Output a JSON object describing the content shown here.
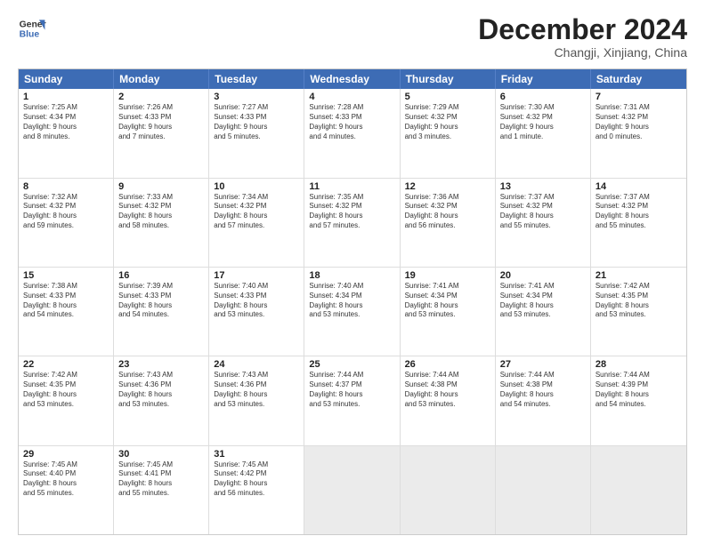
{
  "header": {
    "logo_line1": "General",
    "logo_line2": "Blue",
    "month": "December 2024",
    "location": "Changji, Xinjiang, China"
  },
  "days_of_week": [
    "Sunday",
    "Monday",
    "Tuesday",
    "Wednesday",
    "Thursday",
    "Friday",
    "Saturday"
  ],
  "rows": [
    [
      {
        "day": "1",
        "lines": [
          "Sunrise: 7:25 AM",
          "Sunset: 4:34 PM",
          "Daylight: 9 hours",
          "and 8 minutes."
        ]
      },
      {
        "day": "2",
        "lines": [
          "Sunrise: 7:26 AM",
          "Sunset: 4:33 PM",
          "Daylight: 9 hours",
          "and 7 minutes."
        ]
      },
      {
        "day": "3",
        "lines": [
          "Sunrise: 7:27 AM",
          "Sunset: 4:33 PM",
          "Daylight: 9 hours",
          "and 5 minutes."
        ]
      },
      {
        "day": "4",
        "lines": [
          "Sunrise: 7:28 AM",
          "Sunset: 4:33 PM",
          "Daylight: 9 hours",
          "and 4 minutes."
        ]
      },
      {
        "day": "5",
        "lines": [
          "Sunrise: 7:29 AM",
          "Sunset: 4:32 PM",
          "Daylight: 9 hours",
          "and 3 minutes."
        ]
      },
      {
        "day": "6",
        "lines": [
          "Sunrise: 7:30 AM",
          "Sunset: 4:32 PM",
          "Daylight: 9 hours",
          "and 1 minute."
        ]
      },
      {
        "day": "7",
        "lines": [
          "Sunrise: 7:31 AM",
          "Sunset: 4:32 PM",
          "Daylight: 9 hours",
          "and 0 minutes."
        ]
      }
    ],
    [
      {
        "day": "8",
        "lines": [
          "Sunrise: 7:32 AM",
          "Sunset: 4:32 PM",
          "Daylight: 8 hours",
          "and 59 minutes."
        ]
      },
      {
        "day": "9",
        "lines": [
          "Sunrise: 7:33 AM",
          "Sunset: 4:32 PM",
          "Daylight: 8 hours",
          "and 58 minutes."
        ]
      },
      {
        "day": "10",
        "lines": [
          "Sunrise: 7:34 AM",
          "Sunset: 4:32 PM",
          "Daylight: 8 hours",
          "and 57 minutes."
        ]
      },
      {
        "day": "11",
        "lines": [
          "Sunrise: 7:35 AM",
          "Sunset: 4:32 PM",
          "Daylight: 8 hours",
          "and 57 minutes."
        ]
      },
      {
        "day": "12",
        "lines": [
          "Sunrise: 7:36 AM",
          "Sunset: 4:32 PM",
          "Daylight: 8 hours",
          "and 56 minutes."
        ]
      },
      {
        "day": "13",
        "lines": [
          "Sunrise: 7:37 AM",
          "Sunset: 4:32 PM",
          "Daylight: 8 hours",
          "and 55 minutes."
        ]
      },
      {
        "day": "14",
        "lines": [
          "Sunrise: 7:37 AM",
          "Sunset: 4:32 PM",
          "Daylight: 8 hours",
          "and 55 minutes."
        ]
      }
    ],
    [
      {
        "day": "15",
        "lines": [
          "Sunrise: 7:38 AM",
          "Sunset: 4:33 PM",
          "Daylight: 8 hours",
          "and 54 minutes."
        ]
      },
      {
        "day": "16",
        "lines": [
          "Sunrise: 7:39 AM",
          "Sunset: 4:33 PM",
          "Daylight: 8 hours",
          "and 54 minutes."
        ]
      },
      {
        "day": "17",
        "lines": [
          "Sunrise: 7:40 AM",
          "Sunset: 4:33 PM",
          "Daylight: 8 hours",
          "and 53 minutes."
        ]
      },
      {
        "day": "18",
        "lines": [
          "Sunrise: 7:40 AM",
          "Sunset: 4:34 PM",
          "Daylight: 8 hours",
          "and 53 minutes."
        ]
      },
      {
        "day": "19",
        "lines": [
          "Sunrise: 7:41 AM",
          "Sunset: 4:34 PM",
          "Daylight: 8 hours",
          "and 53 minutes."
        ]
      },
      {
        "day": "20",
        "lines": [
          "Sunrise: 7:41 AM",
          "Sunset: 4:34 PM",
          "Daylight: 8 hours",
          "and 53 minutes."
        ]
      },
      {
        "day": "21",
        "lines": [
          "Sunrise: 7:42 AM",
          "Sunset: 4:35 PM",
          "Daylight: 8 hours",
          "and 53 minutes."
        ]
      }
    ],
    [
      {
        "day": "22",
        "lines": [
          "Sunrise: 7:42 AM",
          "Sunset: 4:35 PM",
          "Daylight: 8 hours",
          "and 53 minutes."
        ]
      },
      {
        "day": "23",
        "lines": [
          "Sunrise: 7:43 AM",
          "Sunset: 4:36 PM",
          "Daylight: 8 hours",
          "and 53 minutes."
        ]
      },
      {
        "day": "24",
        "lines": [
          "Sunrise: 7:43 AM",
          "Sunset: 4:36 PM",
          "Daylight: 8 hours",
          "and 53 minutes."
        ]
      },
      {
        "day": "25",
        "lines": [
          "Sunrise: 7:44 AM",
          "Sunset: 4:37 PM",
          "Daylight: 8 hours",
          "and 53 minutes."
        ]
      },
      {
        "day": "26",
        "lines": [
          "Sunrise: 7:44 AM",
          "Sunset: 4:38 PM",
          "Daylight: 8 hours",
          "and 53 minutes."
        ]
      },
      {
        "day": "27",
        "lines": [
          "Sunrise: 7:44 AM",
          "Sunset: 4:38 PM",
          "Daylight: 8 hours",
          "and 54 minutes."
        ]
      },
      {
        "day": "28",
        "lines": [
          "Sunrise: 7:44 AM",
          "Sunset: 4:39 PM",
          "Daylight: 8 hours",
          "and 54 minutes."
        ]
      }
    ],
    [
      {
        "day": "29",
        "lines": [
          "Sunrise: 7:45 AM",
          "Sunset: 4:40 PM",
          "Daylight: 8 hours",
          "and 55 minutes."
        ]
      },
      {
        "day": "30",
        "lines": [
          "Sunrise: 7:45 AM",
          "Sunset: 4:41 PM",
          "Daylight: 8 hours",
          "and 55 minutes."
        ]
      },
      {
        "day": "31",
        "lines": [
          "Sunrise: 7:45 AM",
          "Sunset: 4:42 PM",
          "Daylight: 8 hours",
          "and 56 minutes."
        ]
      },
      {
        "day": "",
        "lines": []
      },
      {
        "day": "",
        "lines": []
      },
      {
        "day": "",
        "lines": []
      },
      {
        "day": "",
        "lines": []
      }
    ]
  ]
}
